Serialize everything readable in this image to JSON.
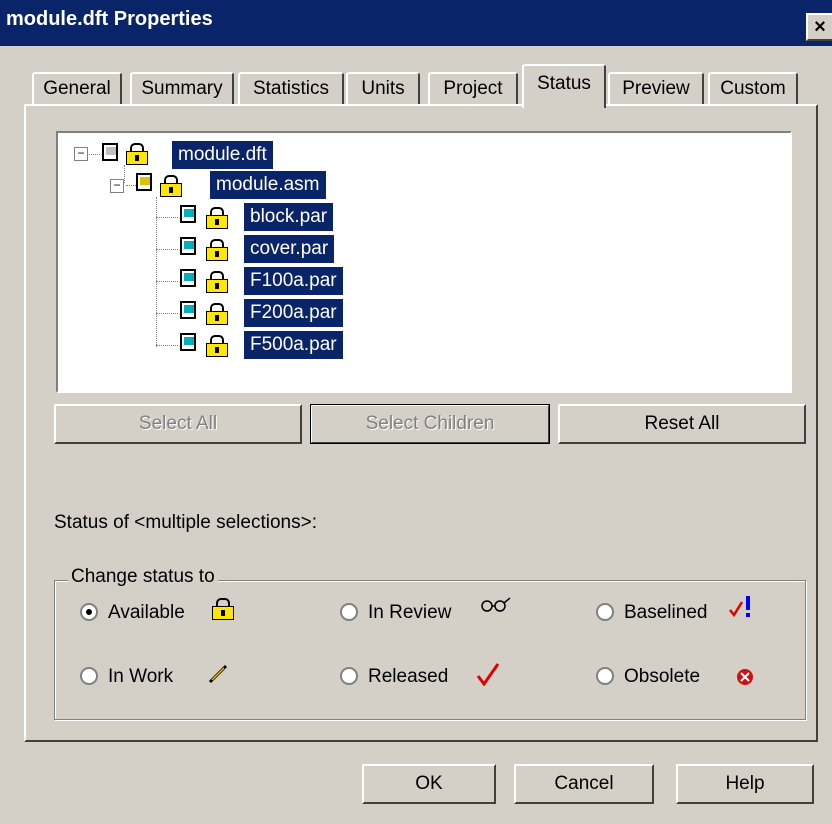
{
  "window": {
    "title": "module.dft Properties",
    "close_glyph": "×"
  },
  "tabs": [
    {
      "label": "General"
    },
    {
      "label": "Summary"
    },
    {
      "label": "Statistics"
    },
    {
      "label": "Units"
    },
    {
      "label": "Project"
    },
    {
      "label": "Status",
      "active": true
    },
    {
      "label": "Preview"
    },
    {
      "label": "Custom"
    }
  ],
  "tree": {
    "nodes": [
      {
        "label": "module.dft",
        "icon": "draft-document-icon",
        "status_icon": "lock-icon",
        "selected": true
      },
      {
        "label": "module.asm",
        "icon": "assembly-document-icon",
        "status_icon": "lock-icon",
        "selected": true
      },
      {
        "label": "block.par",
        "icon": "part-document-icon",
        "status_icon": "lock-icon",
        "selected": true
      },
      {
        "label": "cover.par",
        "icon": "part-document-icon",
        "status_icon": "lock-icon",
        "selected": true
      },
      {
        "label": "F100a.par",
        "icon": "part-document-icon",
        "status_icon": "lock-icon",
        "selected": true
      },
      {
        "label": "F200a.par",
        "icon": "part-document-icon",
        "status_icon": "lock-icon",
        "selected": true
      },
      {
        "label": "F500a.par",
        "icon": "part-document-icon",
        "status_icon": "lock-icon",
        "selected": true
      }
    ]
  },
  "buttons": {
    "select_all": "Select All",
    "select_children": "Select Children",
    "reset_all": "Reset All"
  },
  "status_of": "Status of  <multiple selections>:",
  "change_status": {
    "legend": "Change status to",
    "options": [
      {
        "label": "Available",
        "icon": "lock-icon",
        "checked": true
      },
      {
        "label": "In Review",
        "icon": "glasses-icon",
        "checked": false
      },
      {
        "label": "Baselined",
        "icon": "check-exclamation-icon",
        "checked": false
      },
      {
        "label": "In Work",
        "icon": "pencil-icon",
        "checked": false
      },
      {
        "label": "Released",
        "icon": "checkmark-icon",
        "checked": false
      },
      {
        "label": "Obsolete",
        "icon": "obsolete-x-icon",
        "checked": false
      }
    ]
  },
  "footer": {
    "ok": "OK",
    "cancel": "Cancel",
    "help": "Help"
  },
  "colors": {
    "title_bar": "#0a246a",
    "selection": "#0a246a",
    "face": "#d4d0c8",
    "released_check": "#e00000",
    "baselined_excl": "#0000ff"
  }
}
